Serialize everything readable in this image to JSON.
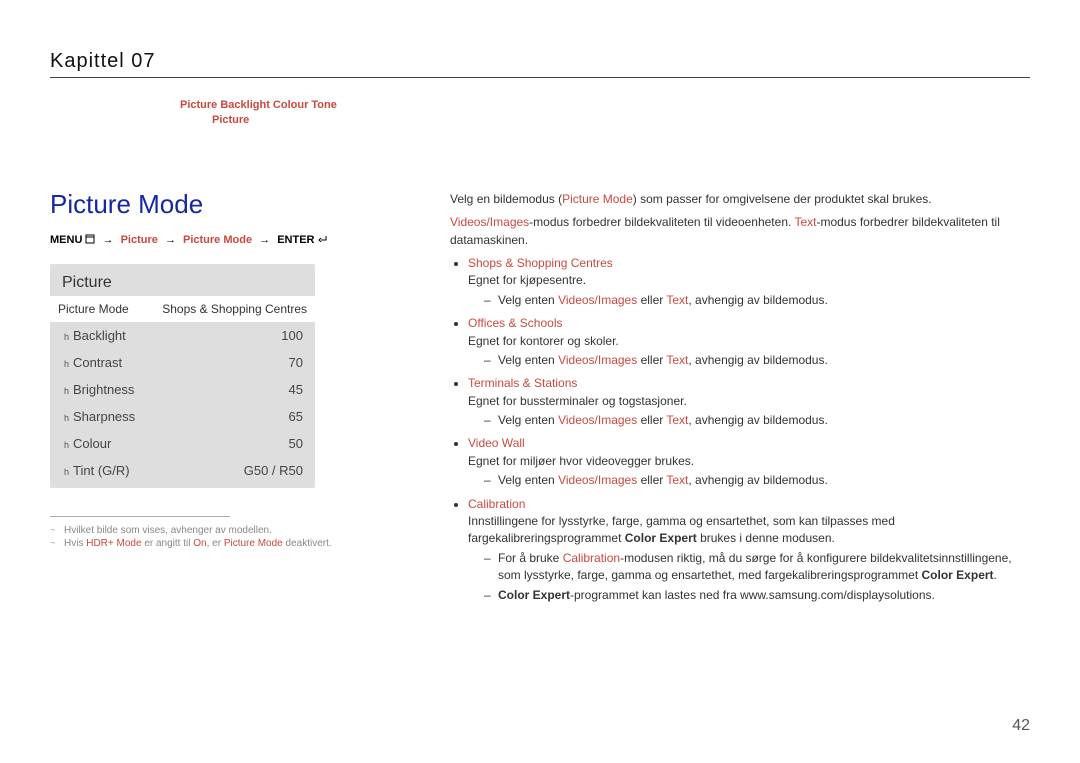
{
  "chapter_brand": "Kapittel 07",
  "header_line1": "Picture  Backlight  Colour Tone",
  "header_line2": "Picture",
  "section_title": "Picture Mode",
  "menu_path": {
    "menu_label": "MENU",
    "step1": "Picture",
    "step2": "Picture Mode",
    "enter_label": "ENTER",
    "arrow": "→"
  },
  "osd": {
    "title": "Picture",
    "mode_row_label": "Picture Mode",
    "mode_row_value": "Shops & Shopping Centres",
    "items": [
      {
        "label": "Backlight",
        "value": "100"
      },
      {
        "label": "Contrast",
        "value": "70"
      },
      {
        "label": "Brightness",
        "value": "45"
      },
      {
        "label": "Sharpness",
        "value": "65"
      },
      {
        "label": "Colour",
        "value": "50"
      },
      {
        "label": "Tint (G/R)",
        "value": "G50 / R50"
      }
    ],
    "slider_mark": "h"
  },
  "footnotes": {
    "fn1": "Hvilket bilde som vises, avhenger av modellen.",
    "fn2_pre": "Hvis ",
    "fn2_hl1": "HDR+ Mode",
    "fn2_mid": " er angitt til ",
    "fn2_on": "On",
    "fn2_mid2": ", er ",
    "fn2_hl2": "Picture Mode",
    "fn2_post": " deaktivert."
  },
  "body": {
    "p1_pre": "Velg en bildemodus (",
    "p1_hl": "Picture Mode",
    "p1_post": ") som passer for omgivelsene der produktet skal brukes.",
    "p2_hl1": "Videos/Images",
    "p2_mid1": "-modus forbedrer bildekvaliteten til videoenheten. ",
    "p2_hl2": "Text",
    "p2_mid2": "-modus forbedrer bildekvaliteten til datamaskinen.",
    "common_sub_pre": "Velg enten ",
    "common_vi": "Videos/Images",
    "common_or": " eller ",
    "common_txt": "Text",
    "common_sub_post": ", avhengig av bildemodus.",
    "bullets": [
      {
        "title": "Shops & Shopping Centres",
        "desc": "Egnet for kjøpesentre."
      },
      {
        "title": "Offices & Schools",
        "desc": "Egnet for kontorer og skoler."
      },
      {
        "title": "Terminals & Stations",
        "desc": "Egnet for bussterminaler og togstasjoner."
      },
      {
        "title": "Video Wall",
        "desc": "Egnet for miljøer hvor videovegger brukes."
      }
    ],
    "calibration": {
      "title": "Calibration",
      "desc_pre": "Innstillingene for lysstyrke, farge, gamma og ensartethet, som kan tilpasses med fargekalibreringsprogrammet ",
      "desc_bold": "Color Expert",
      "desc_post": " brukes i denne modusen.",
      "sub1_pre": "For å bruke ",
      "sub1_hl": "Calibration",
      "sub1_mid": "-modusen riktig, må du sørge for å konfigurere bildekvalitetsinnstillingene, som lysstyrke, farge, gamma og ensartethet, med fargekalibreringsprogrammet ",
      "sub1_bold": "Color Expert",
      "sub1_post": ".",
      "sub2_bold": "Color Expert",
      "sub2_post": "-programmet kan lastes ned fra www.samsung.com/displaysolutions."
    }
  },
  "page_number": "42"
}
